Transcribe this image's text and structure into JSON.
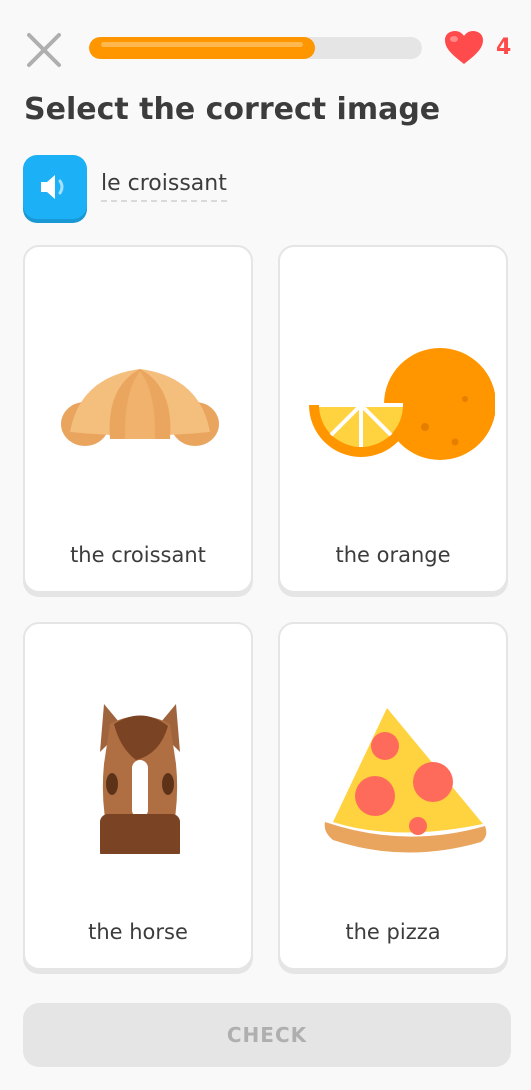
{
  "header": {
    "progress_percent": 68,
    "hearts_count": "4"
  },
  "title": "Select the correct image",
  "prompt": {
    "word": "le croissant"
  },
  "choices": [
    {
      "label": "the croissant",
      "icon": "croissant-icon"
    },
    {
      "label": "the orange",
      "icon": "orange-icon"
    },
    {
      "label": "the horse",
      "icon": "horse-icon"
    },
    {
      "label": "the pizza",
      "icon": "pizza-icon"
    }
  ],
  "footer": {
    "check_label": "CHECK"
  },
  "colors": {
    "progress": "#ff9600",
    "heart": "#ff4b4b",
    "speaker": "#1cb0f6"
  }
}
